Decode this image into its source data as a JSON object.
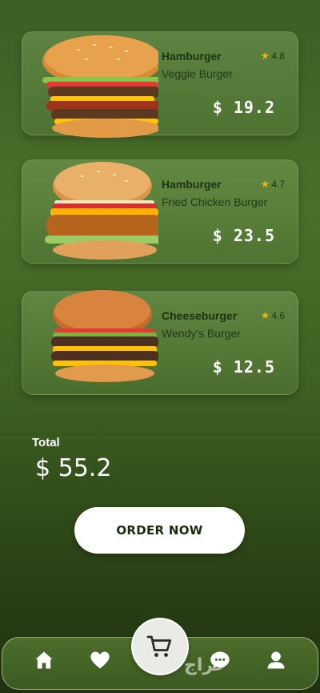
{
  "items": [
    {
      "name": "Hamburger",
      "subtitle": "Veggie Burger",
      "rating": "4.8",
      "price": "$ 19.2"
    },
    {
      "name": "Hamburger",
      "subtitle": "Fried Chicken Burger",
      "rating": "4.7",
      "price": "$ 23.5"
    },
    {
      "name": "Cheeseburger",
      "subtitle": "Wendy's Burger",
      "rating": "4.6",
      "price": "$ 12.5"
    }
  ],
  "total": {
    "label": "Total",
    "value": "$ 55.2"
  },
  "order_button": "ORDER NOW",
  "nav": {
    "icons": [
      "home-icon",
      "heart-icon",
      "cart-icon",
      "chat-icon",
      "profile-icon"
    ],
    "watermark": "حراج"
  },
  "colors": {
    "star": "#e6b800",
    "text_dark": "#1d3312",
    "bg": "#3d5e24"
  }
}
